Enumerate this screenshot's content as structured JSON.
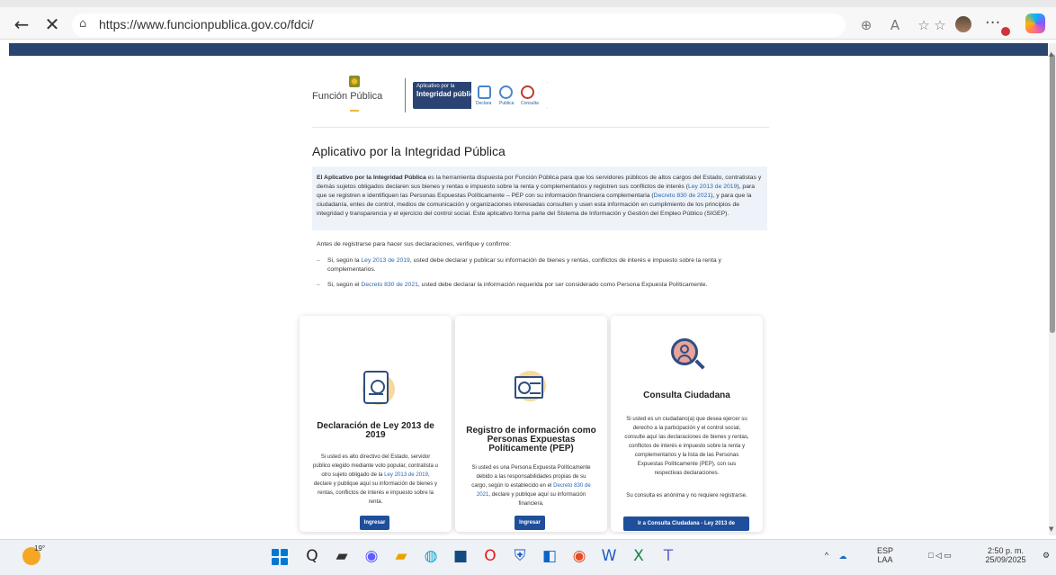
{
  "browser": {
    "back_icon": "←",
    "close_icon": "✕",
    "lock_icon": "⌂",
    "url": "https://www.funcionpublica.gov.co/fdci/",
    "toolbar_icons": [
      "⊕",
      "A",
      "☆",
      "☆"
    ]
  },
  "site": {
    "brand_name": "Función Pública",
    "app_logo_small": "Aplicativo por la",
    "app_logo_name": "Integridad pública",
    "logo_labels": [
      "Declara",
      "Publica",
      "Consulta"
    ],
    "heading": "Aplicativo por la Integridad Pública",
    "intro": {
      "lead_bold": "El Aplicativo por la Integridad Pública",
      "text_1": " es la herramienta dispuesta por Función Pública para que los servidores públicos de altos cargos del Estado, contratistas y demás sujetos obligados declaren sus bienes y rentas e impuesto sobre la renta y complementarios y registren sus conflictos de interés (",
      "link_1": "Ley 2013 de 2019",
      "text_2": "), para que se registren e identifiquen las Personas Expuestas Políticamente – PEP con su información financiera complementaria (",
      "link_2": "Decreto 830 de 2021",
      "text_3": "), y para que la ciudadanía, entes de control, medios de comunicación y organizaciones interesadas consulten y usen esta información en cumplimiento de los principios de integridad y transparencia y el ejercicio del control social. Este aplicativo forma parte del Sistema de Información y Gestión del Empleo Público (SIGEP)."
    },
    "instruction": "Antes de registrarse para hacer sus declaraciones, verifique y confirme:",
    "bullets": [
      {
        "pre": "Si, según la ",
        "link": "Ley 2013 de 2019",
        "post": ", usted debe declarar y publicar su información de bienes y rentas, conflictos de interés e impuesto sobre la renta y complementarios."
      },
      {
        "pre": "Si, según el ",
        "link": "Decreto 830 de 2021",
        "post": ", usted debe declarar la información requerida por ser considerado como Persona Expuesta Políticamente."
      }
    ],
    "cards": [
      {
        "title": "Declaración de Ley 2013 de 2019",
        "body_pre": "Si usted es alto directivo del Estado, servidor público elegido mediante voto popular, contratista u otro sujeto obligado de la ",
        "body_link": "Ley 2013 de 2019",
        "body_post": ", declare y publique aquí su información de bienes y rentas, conflictos de interés e impuesto sobre la renta.",
        "button": "Ingresar"
      },
      {
        "title": "Registro de información como Personas Expuestas Políticamente (PEP)",
        "body_pre": "Si usted es una Persona Expuesta Políticamente debido a las responsabilidades propias de su cargo, según lo establecido en el ",
        "body_link": "Decreto 830 de 2021",
        "body_post": ", declare y publique aquí su información financiera.",
        "button": "Ingresar"
      },
      {
        "title": "Consulta Ciudadana",
        "body": "Si usted es un ciudadano(a) que desea ejercer su derecho a la participación y el control social, consulte aquí las declaraciones de bienes y rentas, conflictos de interés e impuesto sobre la renta y complementarios y la lista de las Personas Expuestas Políticamente (PEP), con sus respectivas declaraciones.",
        "note": "Su consulta es anónima y no requiere registrarse.",
        "button": "Ir a Consulta Ciudadana - Ley 2013 de"
      }
    ]
  },
  "taskbar": {
    "temperature": "19°",
    "language_1": "ESP",
    "language_2": "LAA",
    "time": "2:50 p. m.",
    "date": "25/09/2025",
    "apps": [
      "Q",
      "▰",
      "◉",
      "▰",
      "◍",
      "■",
      "O",
      "⛨",
      "◧",
      "◉",
      "W",
      "X",
      "T"
    ]
  }
}
